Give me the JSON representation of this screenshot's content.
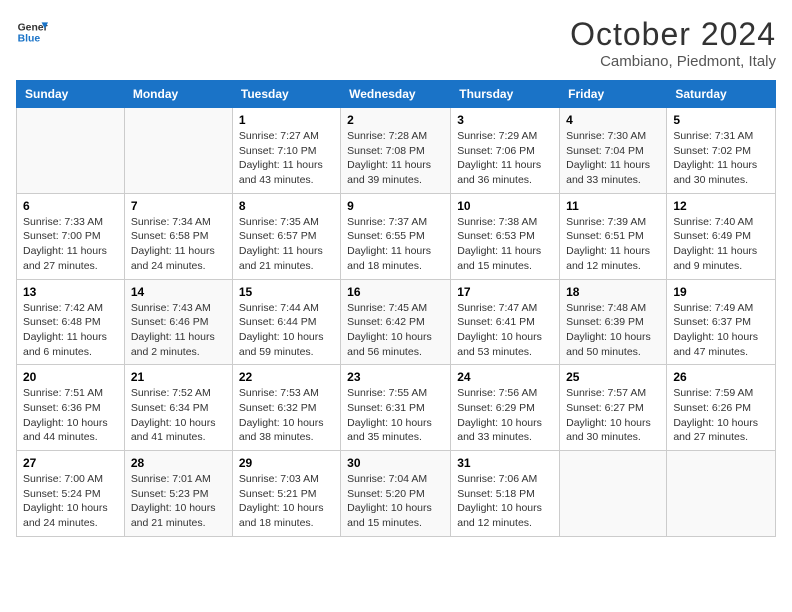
{
  "header": {
    "logo_line1": "General",
    "logo_line2": "Blue",
    "title": "October 2024",
    "subtitle": "Cambiano, Piedmont, Italy"
  },
  "weekdays": [
    "Sunday",
    "Monday",
    "Tuesday",
    "Wednesday",
    "Thursday",
    "Friday",
    "Saturday"
  ],
  "weeks": [
    [
      {
        "day": "",
        "sunrise": "",
        "sunset": "",
        "daylight": ""
      },
      {
        "day": "",
        "sunrise": "",
        "sunset": "",
        "daylight": ""
      },
      {
        "day": "1",
        "sunrise": "Sunrise: 7:27 AM",
        "sunset": "Sunset: 7:10 PM",
        "daylight": "Daylight: 11 hours and 43 minutes."
      },
      {
        "day": "2",
        "sunrise": "Sunrise: 7:28 AM",
        "sunset": "Sunset: 7:08 PM",
        "daylight": "Daylight: 11 hours and 39 minutes."
      },
      {
        "day": "3",
        "sunrise": "Sunrise: 7:29 AM",
        "sunset": "Sunset: 7:06 PM",
        "daylight": "Daylight: 11 hours and 36 minutes."
      },
      {
        "day": "4",
        "sunrise": "Sunrise: 7:30 AM",
        "sunset": "Sunset: 7:04 PM",
        "daylight": "Daylight: 11 hours and 33 minutes."
      },
      {
        "day": "5",
        "sunrise": "Sunrise: 7:31 AM",
        "sunset": "Sunset: 7:02 PM",
        "daylight": "Daylight: 11 hours and 30 minutes."
      }
    ],
    [
      {
        "day": "6",
        "sunrise": "Sunrise: 7:33 AM",
        "sunset": "Sunset: 7:00 PM",
        "daylight": "Daylight: 11 hours and 27 minutes."
      },
      {
        "day": "7",
        "sunrise": "Sunrise: 7:34 AM",
        "sunset": "Sunset: 6:58 PM",
        "daylight": "Daylight: 11 hours and 24 minutes."
      },
      {
        "day": "8",
        "sunrise": "Sunrise: 7:35 AM",
        "sunset": "Sunset: 6:57 PM",
        "daylight": "Daylight: 11 hours and 21 minutes."
      },
      {
        "day": "9",
        "sunrise": "Sunrise: 7:37 AM",
        "sunset": "Sunset: 6:55 PM",
        "daylight": "Daylight: 11 hours and 18 minutes."
      },
      {
        "day": "10",
        "sunrise": "Sunrise: 7:38 AM",
        "sunset": "Sunset: 6:53 PM",
        "daylight": "Daylight: 11 hours and 15 minutes."
      },
      {
        "day": "11",
        "sunrise": "Sunrise: 7:39 AM",
        "sunset": "Sunset: 6:51 PM",
        "daylight": "Daylight: 11 hours and 12 minutes."
      },
      {
        "day": "12",
        "sunrise": "Sunrise: 7:40 AM",
        "sunset": "Sunset: 6:49 PM",
        "daylight": "Daylight: 11 hours and 9 minutes."
      }
    ],
    [
      {
        "day": "13",
        "sunrise": "Sunrise: 7:42 AM",
        "sunset": "Sunset: 6:48 PM",
        "daylight": "Daylight: 11 hours and 6 minutes."
      },
      {
        "day": "14",
        "sunrise": "Sunrise: 7:43 AM",
        "sunset": "Sunset: 6:46 PM",
        "daylight": "Daylight: 11 hours and 2 minutes."
      },
      {
        "day": "15",
        "sunrise": "Sunrise: 7:44 AM",
        "sunset": "Sunset: 6:44 PM",
        "daylight": "Daylight: 10 hours and 59 minutes."
      },
      {
        "day": "16",
        "sunrise": "Sunrise: 7:45 AM",
        "sunset": "Sunset: 6:42 PM",
        "daylight": "Daylight: 10 hours and 56 minutes."
      },
      {
        "day": "17",
        "sunrise": "Sunrise: 7:47 AM",
        "sunset": "Sunset: 6:41 PM",
        "daylight": "Daylight: 10 hours and 53 minutes."
      },
      {
        "day": "18",
        "sunrise": "Sunrise: 7:48 AM",
        "sunset": "Sunset: 6:39 PM",
        "daylight": "Daylight: 10 hours and 50 minutes."
      },
      {
        "day": "19",
        "sunrise": "Sunrise: 7:49 AM",
        "sunset": "Sunset: 6:37 PM",
        "daylight": "Daylight: 10 hours and 47 minutes."
      }
    ],
    [
      {
        "day": "20",
        "sunrise": "Sunrise: 7:51 AM",
        "sunset": "Sunset: 6:36 PM",
        "daylight": "Daylight: 10 hours and 44 minutes."
      },
      {
        "day": "21",
        "sunrise": "Sunrise: 7:52 AM",
        "sunset": "Sunset: 6:34 PM",
        "daylight": "Daylight: 10 hours and 41 minutes."
      },
      {
        "day": "22",
        "sunrise": "Sunrise: 7:53 AM",
        "sunset": "Sunset: 6:32 PM",
        "daylight": "Daylight: 10 hours and 38 minutes."
      },
      {
        "day": "23",
        "sunrise": "Sunrise: 7:55 AM",
        "sunset": "Sunset: 6:31 PM",
        "daylight": "Daylight: 10 hours and 35 minutes."
      },
      {
        "day": "24",
        "sunrise": "Sunrise: 7:56 AM",
        "sunset": "Sunset: 6:29 PM",
        "daylight": "Daylight: 10 hours and 33 minutes."
      },
      {
        "day": "25",
        "sunrise": "Sunrise: 7:57 AM",
        "sunset": "Sunset: 6:27 PM",
        "daylight": "Daylight: 10 hours and 30 minutes."
      },
      {
        "day": "26",
        "sunrise": "Sunrise: 7:59 AM",
        "sunset": "Sunset: 6:26 PM",
        "daylight": "Daylight: 10 hours and 27 minutes."
      }
    ],
    [
      {
        "day": "27",
        "sunrise": "Sunrise: 7:00 AM",
        "sunset": "Sunset: 5:24 PM",
        "daylight": "Daylight: 10 hours and 24 minutes."
      },
      {
        "day": "28",
        "sunrise": "Sunrise: 7:01 AM",
        "sunset": "Sunset: 5:23 PM",
        "daylight": "Daylight: 10 hours and 21 minutes."
      },
      {
        "day": "29",
        "sunrise": "Sunrise: 7:03 AM",
        "sunset": "Sunset: 5:21 PM",
        "daylight": "Daylight: 10 hours and 18 minutes."
      },
      {
        "day": "30",
        "sunrise": "Sunrise: 7:04 AM",
        "sunset": "Sunset: 5:20 PM",
        "daylight": "Daylight: 10 hours and 15 minutes."
      },
      {
        "day": "31",
        "sunrise": "Sunrise: 7:06 AM",
        "sunset": "Sunset: 5:18 PM",
        "daylight": "Daylight: 10 hours and 12 minutes."
      },
      {
        "day": "",
        "sunrise": "",
        "sunset": "",
        "daylight": ""
      },
      {
        "day": "",
        "sunrise": "",
        "sunset": "",
        "daylight": ""
      }
    ]
  ]
}
